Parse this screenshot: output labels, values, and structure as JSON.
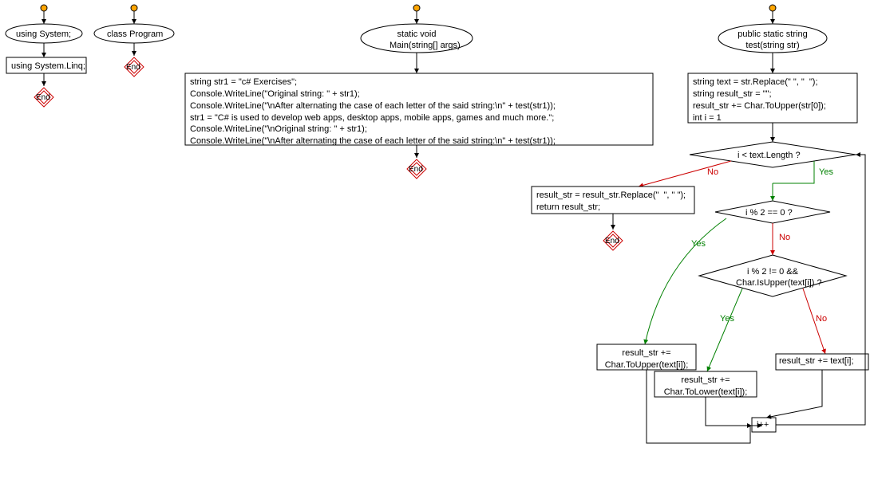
{
  "nodes": {
    "usingSystem": "using System;",
    "usingSystemLinq": "using System.Linq;",
    "classProgram": "class Program",
    "mainSignature": "static void\nMain(string[] args)",
    "mainBody": "string str1 = \"c# Exercises\";\nConsole.WriteLine(\"Original string: \" + str1);\nConsole.WriteLine(\"\\nAfter alternating the case of each letter of the said string:\\n\" + test(str1));\nstr1 = \"C# is used to develop web apps, desktop apps, mobile apps, games and much more.\";\nConsole.WriteLine(\"\\nOriginal string: \" + str1);\nConsole.WriteLine(\"\\nAfter alternating the case of each letter of the said string:\\n\" + test(str1));",
    "testSignature": "public static string\ntest(string str)",
    "testInit": "string text = str.Replace(\" \", \"  \");\nstring result_str = \"\";\nresult_str += Char.ToUpper(str[0]);\nint i = 1",
    "cond1": "i < text.Length ?",
    "cond2": "i % 2 == 0 ?",
    "cond3": "i % 2 != 0 &&\nChar.IsUpper(text[i]) ?",
    "actionUpper": "result_str +=\nChar.ToUpper(text[i]);",
    "actionLower": "result_str +=\nChar.ToLower(text[i]);",
    "actionText": "result_str += text[i];",
    "actionInc": "i++",
    "returnBlock": "result_str = result_str.Replace(\"  \", \" \");\nreturn result_str;",
    "end": "End"
  },
  "labels": {
    "yes": "Yes",
    "no": "No"
  },
  "colors": {
    "stroke": "#000000",
    "entryFill": "#ffa500",
    "endStroke": "#cc0000",
    "yes": "#008000",
    "no": "#cc0000"
  }
}
